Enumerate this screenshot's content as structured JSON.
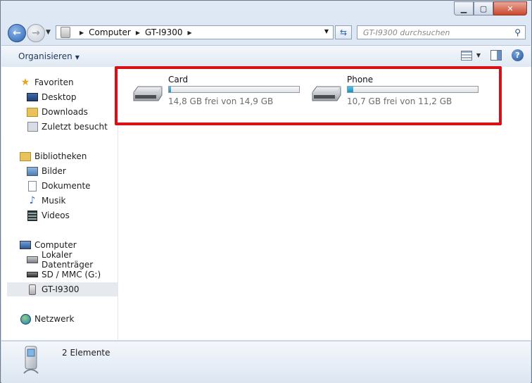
{
  "window": {
    "buttons": {
      "minimize_icon": "minimize-icon",
      "maximize_icon": "maximize-icon",
      "close_icon": "close-icon"
    }
  },
  "address_bar": {
    "breadcrumbs": [
      "Computer",
      "GT-I9300"
    ],
    "search_placeholder": "GT-I9300 durchsuchen"
  },
  "toolbar": {
    "organize_label": "Organisieren"
  },
  "sidebar": {
    "favorites": {
      "label": "Favoriten",
      "items": [
        "Desktop",
        "Downloads",
        "Zuletzt besucht"
      ]
    },
    "libraries": {
      "label": "Bibliotheken",
      "items": [
        "Bilder",
        "Dokumente",
        "Musik",
        "Videos"
      ]
    },
    "computer": {
      "label": "Computer",
      "items": [
        "Lokaler Datenträger",
        "SD / MMC (G:)",
        "GT-I9300"
      ],
      "selected": "GT-I9300"
    },
    "network": {
      "label": "Netzwerk"
    }
  },
  "drives": [
    {
      "name": "Card",
      "free_text": "14,8 GB frei von 14,9 GB",
      "used_fraction": 0.007
    },
    {
      "name": "Phone",
      "free_text": "10,7 GB frei von 11,2 GB",
      "used_fraction": 0.045
    }
  ],
  "status": {
    "item_count": "2 Elemente"
  },
  "colors": {
    "highlight_border": "#d90f16",
    "usage_bar": "#1e8fbf"
  }
}
